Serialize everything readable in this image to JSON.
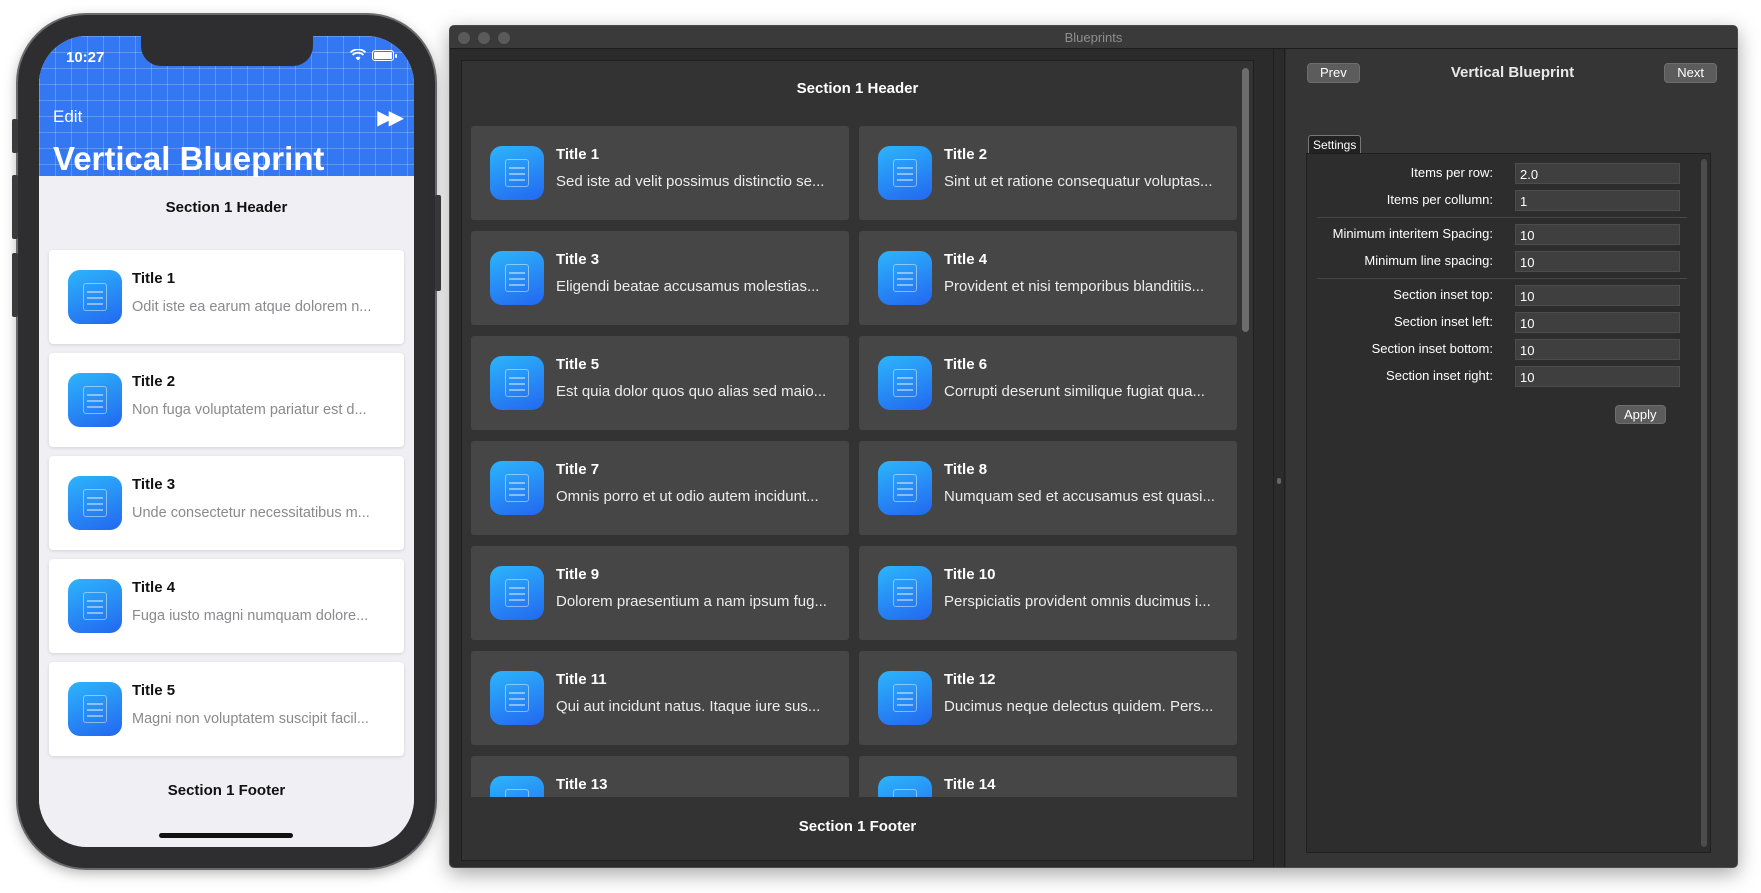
{
  "phone": {
    "status_time": "10:27",
    "nav_edit": "Edit",
    "nav_ff_icon": "fast-forward-icon",
    "large_title": "Vertical Blueprint",
    "section_header": "Section 1 Header",
    "section_footer": "Section 1 Footer",
    "items": [
      {
        "title": "Title 1",
        "subtitle": "Odit iste ea earum atque dolorem n..."
      },
      {
        "title": "Title 2",
        "subtitle": "Non fuga voluptatem pariatur est d..."
      },
      {
        "title": "Title 3",
        "subtitle": "Unde consectetur necessitatibus m..."
      },
      {
        "title": "Title 4",
        "subtitle": "Fuga iusto magni numquam dolore..."
      },
      {
        "title": "Title 5",
        "subtitle": "Magni non voluptatem suscipit facil..."
      }
    ]
  },
  "mac": {
    "window_title": "Blueprints",
    "section_header": "Section 1 Header",
    "section_footer": "Section 1 Footer",
    "items": [
      {
        "title": "Title 1",
        "subtitle": "Sed iste ad velit possimus distinctio se..."
      },
      {
        "title": "Title 2",
        "subtitle": "Sint ut et ratione consequatur voluptas..."
      },
      {
        "title": "Title 3",
        "subtitle": "Eligendi beatae accusamus molestias..."
      },
      {
        "title": "Title 4",
        "subtitle": "Provident et nisi temporibus blanditiis..."
      },
      {
        "title": "Title 5",
        "subtitle": "Est quia dolor quos quo alias sed maio..."
      },
      {
        "title": "Title 6",
        "subtitle": "Corrupti deserunt similique fugiat qua..."
      },
      {
        "title": "Title 7",
        "subtitle": "Omnis porro et ut odio autem incidunt..."
      },
      {
        "title": "Title 8",
        "subtitle": "Numquam sed et accusamus est quasi..."
      },
      {
        "title": "Title 9",
        "subtitle": "Dolorem praesentium a nam ipsum fug..."
      },
      {
        "title": "Title 10",
        "subtitle": "Perspiciatis provident omnis ducimus i..."
      },
      {
        "title": "Title 11",
        "subtitle": "Qui aut incidunt natus. Itaque iure sus..."
      },
      {
        "title": "Title 12",
        "subtitle": "Ducimus neque delectus quidem. Pers..."
      },
      {
        "title": "Title 13",
        "subtitle": ""
      },
      {
        "title": "Title 14",
        "subtitle": ""
      }
    ],
    "sidebar": {
      "prev_label": "Prev",
      "next_label": "Next",
      "title": "Vertical Blueprint",
      "tab_label": "Settings",
      "apply_label": "Apply",
      "fields": [
        {
          "label": "Items per row:",
          "value": "2.0"
        },
        {
          "label": "Items per collumn:",
          "value": "1"
        },
        {
          "label": "Minimum interitem Spacing:",
          "value": "10"
        },
        {
          "label": "Minimum line spacing:",
          "value": "10"
        },
        {
          "label": "Section inset top:",
          "value": "10"
        },
        {
          "label": "Section inset left:",
          "value": "10"
        },
        {
          "label": "Section inset bottom:",
          "value": "10"
        },
        {
          "label": "Section inset right:",
          "value": "10"
        }
      ]
    }
  },
  "colors": {
    "ios_nav_blue": "#3377f2",
    "icon_gradient_top": "#2cb5fb",
    "icon_gradient_bottom": "#2367f0",
    "mac_cell_bg": "#464646"
  }
}
